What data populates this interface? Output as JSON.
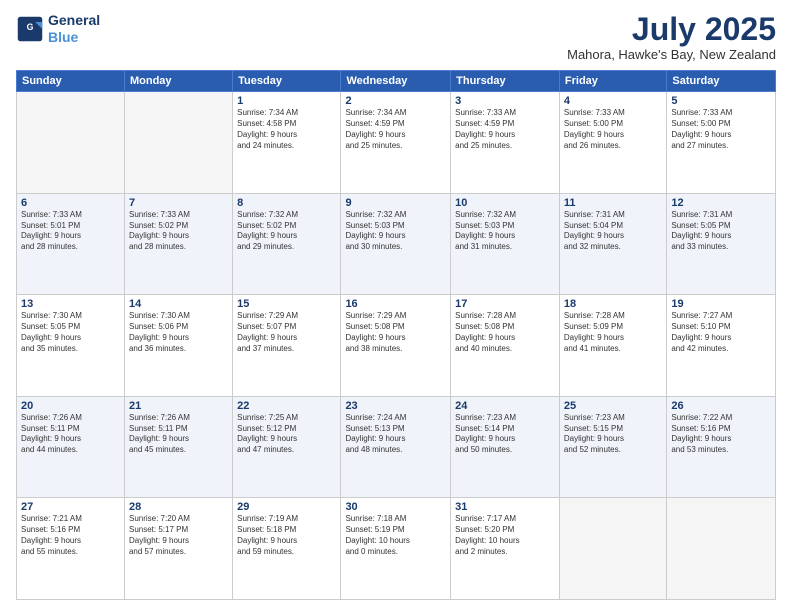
{
  "logo": {
    "line1": "General",
    "line2": "Blue"
  },
  "header": {
    "month": "July 2025",
    "location": "Mahora, Hawke's Bay, New Zealand"
  },
  "weekdays": [
    "Sunday",
    "Monday",
    "Tuesday",
    "Wednesday",
    "Thursday",
    "Friday",
    "Saturday"
  ],
  "weeks": [
    [
      {
        "day": "",
        "info": ""
      },
      {
        "day": "",
        "info": ""
      },
      {
        "day": "1",
        "info": "Sunrise: 7:34 AM\nSunset: 4:58 PM\nDaylight: 9 hours\nand 24 minutes."
      },
      {
        "day": "2",
        "info": "Sunrise: 7:34 AM\nSunset: 4:59 PM\nDaylight: 9 hours\nand 25 minutes."
      },
      {
        "day": "3",
        "info": "Sunrise: 7:33 AM\nSunset: 4:59 PM\nDaylight: 9 hours\nand 25 minutes."
      },
      {
        "day": "4",
        "info": "Sunrise: 7:33 AM\nSunset: 5:00 PM\nDaylight: 9 hours\nand 26 minutes."
      },
      {
        "day": "5",
        "info": "Sunrise: 7:33 AM\nSunset: 5:00 PM\nDaylight: 9 hours\nand 27 minutes."
      }
    ],
    [
      {
        "day": "6",
        "info": "Sunrise: 7:33 AM\nSunset: 5:01 PM\nDaylight: 9 hours\nand 28 minutes."
      },
      {
        "day": "7",
        "info": "Sunrise: 7:33 AM\nSunset: 5:02 PM\nDaylight: 9 hours\nand 28 minutes."
      },
      {
        "day": "8",
        "info": "Sunrise: 7:32 AM\nSunset: 5:02 PM\nDaylight: 9 hours\nand 29 minutes."
      },
      {
        "day": "9",
        "info": "Sunrise: 7:32 AM\nSunset: 5:03 PM\nDaylight: 9 hours\nand 30 minutes."
      },
      {
        "day": "10",
        "info": "Sunrise: 7:32 AM\nSunset: 5:03 PM\nDaylight: 9 hours\nand 31 minutes."
      },
      {
        "day": "11",
        "info": "Sunrise: 7:31 AM\nSunset: 5:04 PM\nDaylight: 9 hours\nand 32 minutes."
      },
      {
        "day": "12",
        "info": "Sunrise: 7:31 AM\nSunset: 5:05 PM\nDaylight: 9 hours\nand 33 minutes."
      }
    ],
    [
      {
        "day": "13",
        "info": "Sunrise: 7:30 AM\nSunset: 5:05 PM\nDaylight: 9 hours\nand 35 minutes."
      },
      {
        "day": "14",
        "info": "Sunrise: 7:30 AM\nSunset: 5:06 PM\nDaylight: 9 hours\nand 36 minutes."
      },
      {
        "day": "15",
        "info": "Sunrise: 7:29 AM\nSunset: 5:07 PM\nDaylight: 9 hours\nand 37 minutes."
      },
      {
        "day": "16",
        "info": "Sunrise: 7:29 AM\nSunset: 5:08 PM\nDaylight: 9 hours\nand 38 minutes."
      },
      {
        "day": "17",
        "info": "Sunrise: 7:28 AM\nSunset: 5:08 PM\nDaylight: 9 hours\nand 40 minutes."
      },
      {
        "day": "18",
        "info": "Sunrise: 7:28 AM\nSunset: 5:09 PM\nDaylight: 9 hours\nand 41 minutes."
      },
      {
        "day": "19",
        "info": "Sunrise: 7:27 AM\nSunset: 5:10 PM\nDaylight: 9 hours\nand 42 minutes."
      }
    ],
    [
      {
        "day": "20",
        "info": "Sunrise: 7:26 AM\nSunset: 5:11 PM\nDaylight: 9 hours\nand 44 minutes."
      },
      {
        "day": "21",
        "info": "Sunrise: 7:26 AM\nSunset: 5:11 PM\nDaylight: 9 hours\nand 45 minutes."
      },
      {
        "day": "22",
        "info": "Sunrise: 7:25 AM\nSunset: 5:12 PM\nDaylight: 9 hours\nand 47 minutes."
      },
      {
        "day": "23",
        "info": "Sunrise: 7:24 AM\nSunset: 5:13 PM\nDaylight: 9 hours\nand 48 minutes."
      },
      {
        "day": "24",
        "info": "Sunrise: 7:23 AM\nSunset: 5:14 PM\nDaylight: 9 hours\nand 50 minutes."
      },
      {
        "day": "25",
        "info": "Sunrise: 7:23 AM\nSunset: 5:15 PM\nDaylight: 9 hours\nand 52 minutes."
      },
      {
        "day": "26",
        "info": "Sunrise: 7:22 AM\nSunset: 5:16 PM\nDaylight: 9 hours\nand 53 minutes."
      }
    ],
    [
      {
        "day": "27",
        "info": "Sunrise: 7:21 AM\nSunset: 5:16 PM\nDaylight: 9 hours\nand 55 minutes."
      },
      {
        "day": "28",
        "info": "Sunrise: 7:20 AM\nSunset: 5:17 PM\nDaylight: 9 hours\nand 57 minutes."
      },
      {
        "day": "29",
        "info": "Sunrise: 7:19 AM\nSunset: 5:18 PM\nDaylight: 9 hours\nand 59 minutes."
      },
      {
        "day": "30",
        "info": "Sunrise: 7:18 AM\nSunset: 5:19 PM\nDaylight: 10 hours\nand 0 minutes."
      },
      {
        "day": "31",
        "info": "Sunrise: 7:17 AM\nSunset: 5:20 PM\nDaylight: 10 hours\nand 2 minutes."
      },
      {
        "day": "",
        "info": ""
      },
      {
        "day": "",
        "info": ""
      }
    ]
  ]
}
